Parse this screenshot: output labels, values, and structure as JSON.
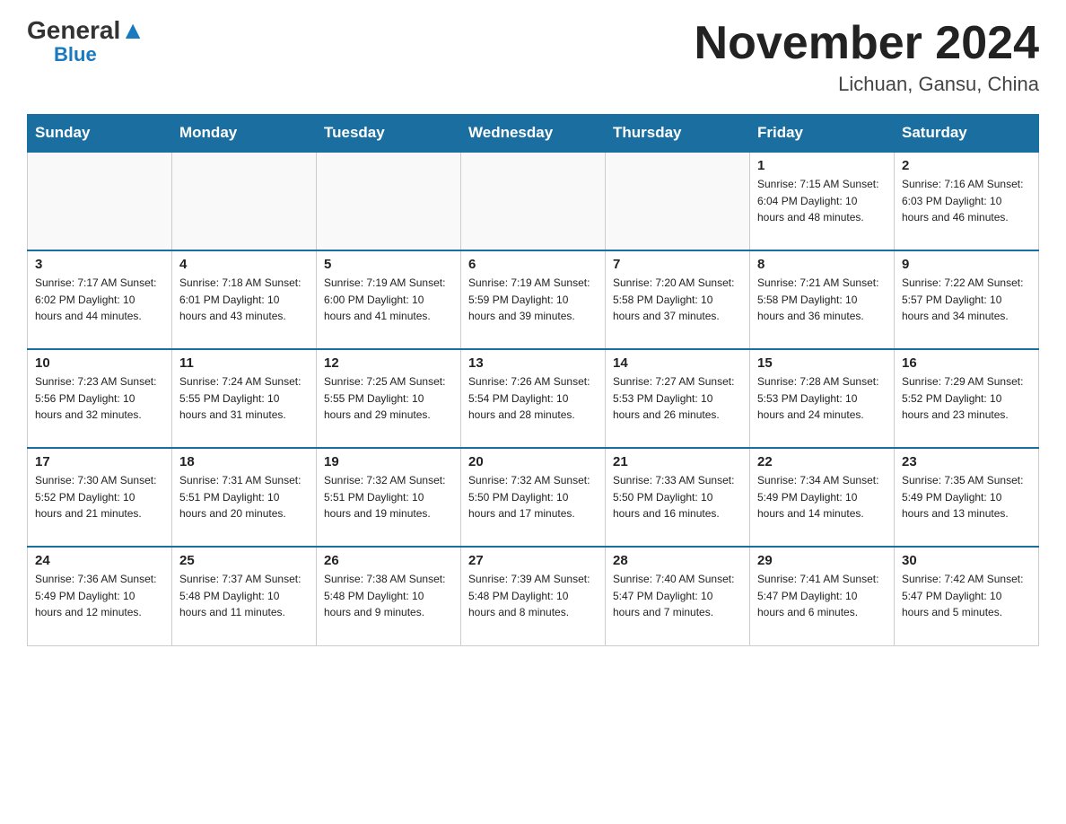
{
  "header": {
    "logo_general": "General",
    "logo_blue": "Blue",
    "title": "November 2024",
    "subtitle": "Lichuan, Gansu, China"
  },
  "days_of_week": [
    "Sunday",
    "Monday",
    "Tuesday",
    "Wednesday",
    "Thursday",
    "Friday",
    "Saturday"
  ],
  "weeks": [
    [
      {
        "day": "",
        "info": ""
      },
      {
        "day": "",
        "info": ""
      },
      {
        "day": "",
        "info": ""
      },
      {
        "day": "",
        "info": ""
      },
      {
        "day": "",
        "info": ""
      },
      {
        "day": "1",
        "info": "Sunrise: 7:15 AM\nSunset: 6:04 PM\nDaylight: 10 hours and 48 minutes."
      },
      {
        "day": "2",
        "info": "Sunrise: 7:16 AM\nSunset: 6:03 PM\nDaylight: 10 hours and 46 minutes."
      }
    ],
    [
      {
        "day": "3",
        "info": "Sunrise: 7:17 AM\nSunset: 6:02 PM\nDaylight: 10 hours and 44 minutes."
      },
      {
        "day": "4",
        "info": "Sunrise: 7:18 AM\nSunset: 6:01 PM\nDaylight: 10 hours and 43 minutes."
      },
      {
        "day": "5",
        "info": "Sunrise: 7:19 AM\nSunset: 6:00 PM\nDaylight: 10 hours and 41 minutes."
      },
      {
        "day": "6",
        "info": "Sunrise: 7:19 AM\nSunset: 5:59 PM\nDaylight: 10 hours and 39 minutes."
      },
      {
        "day": "7",
        "info": "Sunrise: 7:20 AM\nSunset: 5:58 PM\nDaylight: 10 hours and 37 minutes."
      },
      {
        "day": "8",
        "info": "Sunrise: 7:21 AM\nSunset: 5:58 PM\nDaylight: 10 hours and 36 minutes."
      },
      {
        "day": "9",
        "info": "Sunrise: 7:22 AM\nSunset: 5:57 PM\nDaylight: 10 hours and 34 minutes."
      }
    ],
    [
      {
        "day": "10",
        "info": "Sunrise: 7:23 AM\nSunset: 5:56 PM\nDaylight: 10 hours and 32 minutes."
      },
      {
        "day": "11",
        "info": "Sunrise: 7:24 AM\nSunset: 5:55 PM\nDaylight: 10 hours and 31 minutes."
      },
      {
        "day": "12",
        "info": "Sunrise: 7:25 AM\nSunset: 5:55 PM\nDaylight: 10 hours and 29 minutes."
      },
      {
        "day": "13",
        "info": "Sunrise: 7:26 AM\nSunset: 5:54 PM\nDaylight: 10 hours and 28 minutes."
      },
      {
        "day": "14",
        "info": "Sunrise: 7:27 AM\nSunset: 5:53 PM\nDaylight: 10 hours and 26 minutes."
      },
      {
        "day": "15",
        "info": "Sunrise: 7:28 AM\nSunset: 5:53 PM\nDaylight: 10 hours and 24 minutes."
      },
      {
        "day": "16",
        "info": "Sunrise: 7:29 AM\nSunset: 5:52 PM\nDaylight: 10 hours and 23 minutes."
      }
    ],
    [
      {
        "day": "17",
        "info": "Sunrise: 7:30 AM\nSunset: 5:52 PM\nDaylight: 10 hours and 21 minutes."
      },
      {
        "day": "18",
        "info": "Sunrise: 7:31 AM\nSunset: 5:51 PM\nDaylight: 10 hours and 20 minutes."
      },
      {
        "day": "19",
        "info": "Sunrise: 7:32 AM\nSunset: 5:51 PM\nDaylight: 10 hours and 19 minutes."
      },
      {
        "day": "20",
        "info": "Sunrise: 7:32 AM\nSunset: 5:50 PM\nDaylight: 10 hours and 17 minutes."
      },
      {
        "day": "21",
        "info": "Sunrise: 7:33 AM\nSunset: 5:50 PM\nDaylight: 10 hours and 16 minutes."
      },
      {
        "day": "22",
        "info": "Sunrise: 7:34 AM\nSunset: 5:49 PM\nDaylight: 10 hours and 14 minutes."
      },
      {
        "day": "23",
        "info": "Sunrise: 7:35 AM\nSunset: 5:49 PM\nDaylight: 10 hours and 13 minutes."
      }
    ],
    [
      {
        "day": "24",
        "info": "Sunrise: 7:36 AM\nSunset: 5:49 PM\nDaylight: 10 hours and 12 minutes."
      },
      {
        "day": "25",
        "info": "Sunrise: 7:37 AM\nSunset: 5:48 PM\nDaylight: 10 hours and 11 minutes."
      },
      {
        "day": "26",
        "info": "Sunrise: 7:38 AM\nSunset: 5:48 PM\nDaylight: 10 hours and 9 minutes."
      },
      {
        "day": "27",
        "info": "Sunrise: 7:39 AM\nSunset: 5:48 PM\nDaylight: 10 hours and 8 minutes."
      },
      {
        "day": "28",
        "info": "Sunrise: 7:40 AM\nSunset: 5:47 PM\nDaylight: 10 hours and 7 minutes."
      },
      {
        "day": "29",
        "info": "Sunrise: 7:41 AM\nSunset: 5:47 PM\nDaylight: 10 hours and 6 minutes."
      },
      {
        "day": "30",
        "info": "Sunrise: 7:42 AM\nSunset: 5:47 PM\nDaylight: 10 hours and 5 minutes."
      }
    ]
  ]
}
